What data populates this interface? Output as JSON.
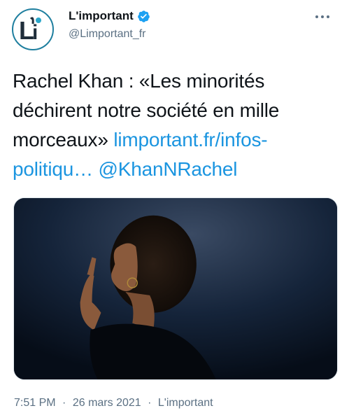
{
  "author": {
    "name": "L'important",
    "handle": "@Limportant_fr",
    "avatar_text": "L'i",
    "verified": true
  },
  "tweet": {
    "text": "Rachel Khan : «Les minorités déchirent notre société en mille morceaux»",
    "link": "limportant.fr/infos-politiqu…",
    "mention": "@KhanNRachel"
  },
  "media": {
    "description": "Photo of a woman in profile with finger to lips"
  },
  "meta": {
    "time": "7:51 PM",
    "separator": "·",
    "date": "26 mars 2021",
    "source": "L'important"
  },
  "colors": {
    "link": "#1b95e0",
    "verified": "#1da1f2",
    "avatar_accent": "#1f7f9f",
    "secondary_text": "#5b7083"
  },
  "icons": [
    "verified-badge-icon",
    "more-options-icon"
  ]
}
